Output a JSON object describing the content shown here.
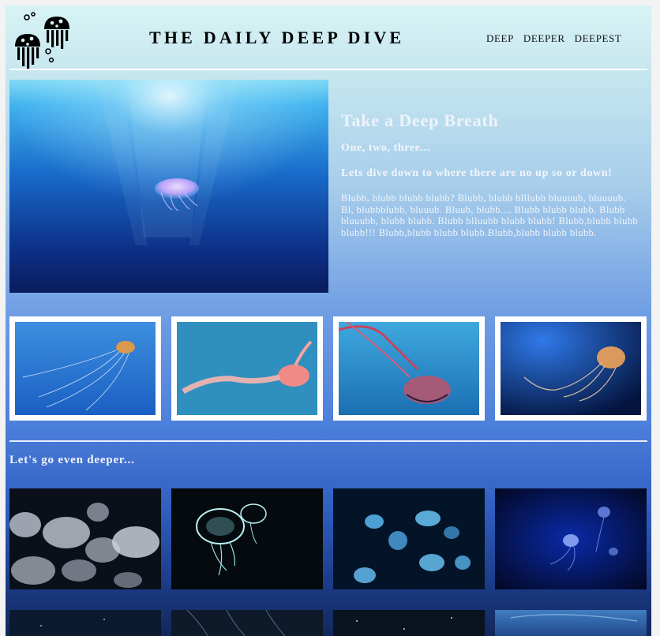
{
  "header": {
    "title": "THE DAILY DEEP DIVE",
    "logo_icon": "jellyfish-logo-icon",
    "nav": [
      "DEEP",
      "DEEPER",
      "DEEPEST"
    ]
  },
  "hero": {
    "image_icon": "jellyfish-photo",
    "heading": "Take a Deep Breath",
    "subheading1": "One, two, three...",
    "subheading2": "Lets dive down to where there are no up so or down!",
    "body": "Blubb, blubb blubb blubb? Blubb, blubb blllubb bluuuub, bluuuub. Bl, blubbblubb, bluuub. Bluub, blubb.... Blubb blubb blubb. Blubb bluuubb, blubb blubb. Blubb blluubb blubb blubb! Blubb,blubb blubb blubb!!! Blubb,blubb blubb blubb.Blubb,blubb blubb blubb."
  },
  "section": {
    "title": "Let's go even deeper..."
  },
  "colors": {
    "page_top": "#d7f3f4",
    "page_bottom": "#12275a",
    "rule": "#ffffff"
  }
}
